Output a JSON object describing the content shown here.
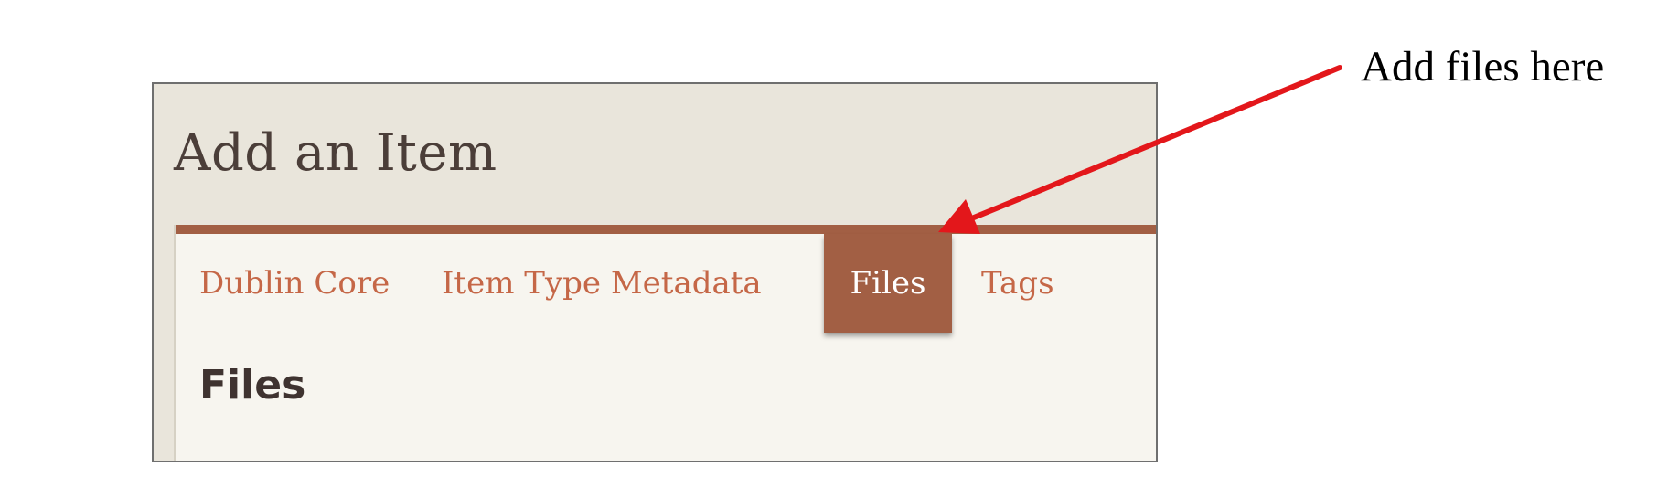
{
  "page": {
    "title": "Add an Item",
    "section_heading": "Files"
  },
  "tabs": [
    {
      "label": "Dublin Core",
      "active": false
    },
    {
      "label": "Item Type Metadata",
      "active": false
    },
    {
      "label": "Files",
      "active": true
    },
    {
      "label": "Tags",
      "active": false
    }
  ],
  "annotation": {
    "text": "Add files here",
    "color": "#e3171b"
  },
  "colors": {
    "accent": "#a25f44",
    "tab_text": "#c56747",
    "panel_background": "#f7f5ef",
    "header_background": "#e9e5db"
  }
}
